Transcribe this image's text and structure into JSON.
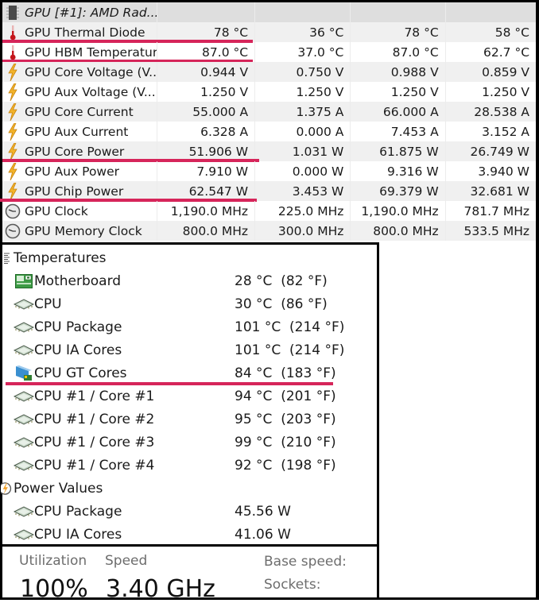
{
  "gpu_table": {
    "header": {
      "device_label": "GPU [#1]: AMD Rad...",
      "icon": "chip-icon"
    },
    "rows": [
      {
        "icon": "thermometer-icon",
        "name": "GPU Thermal Diode",
        "current": "78 °C",
        "min": "36 °C",
        "max": "78 °C",
        "avg": "58 °C",
        "highlighted": true
      },
      {
        "icon": "thermometer-icon",
        "name": "GPU HBM Temperature",
        "current": "87.0 °C",
        "min": "37.0 °C",
        "max": "87.0 °C",
        "avg": "62.7 °C",
        "highlighted": true
      },
      {
        "icon": "lightning-icon",
        "name": "GPU Core Voltage (V...",
        "current": "0.944 V",
        "min": "0.750 V",
        "max": "0.988 V",
        "avg": "0.859 V",
        "highlighted": false
      },
      {
        "icon": "lightning-icon",
        "name": "GPU Aux Voltage (V...",
        "current": "1.250 V",
        "min": "1.250 V",
        "max": "1.250 V",
        "avg": "1.250 V",
        "highlighted": false
      },
      {
        "icon": "lightning-icon",
        "name": "GPU Core Current",
        "current": "55.000 A",
        "min": "1.375 A",
        "max": "66.000 A",
        "avg": "28.538 A",
        "highlighted": false
      },
      {
        "icon": "lightning-icon",
        "name": "GPU Aux Current",
        "current": "6.328 A",
        "min": "0.000 A",
        "max": "7.453 A",
        "avg": "3.152 A",
        "highlighted": false
      },
      {
        "icon": "lightning-icon",
        "name": "GPU Core Power",
        "current": "51.906 W",
        "min": "1.031 W",
        "max": "61.875 W",
        "avg": "26.749 W",
        "highlighted": true
      },
      {
        "icon": "lightning-icon",
        "name": "GPU Aux Power",
        "current": "7.910 W",
        "min": "0.000 W",
        "max": "9.316 W",
        "avg": "3.940 W",
        "highlighted": false
      },
      {
        "icon": "lightning-icon",
        "name": "GPU Chip Power",
        "current": "62.547 W",
        "min": "3.453 W",
        "max": "69.379 W",
        "avg": "32.681 W",
        "highlighted": true
      },
      {
        "icon": "clock-icon",
        "name": "GPU Clock",
        "current": "1,190.0 MHz",
        "min": "225.0 MHz",
        "max": "1,190.0 MHz",
        "avg": "781.7 MHz",
        "highlighted": false
      },
      {
        "icon": "clock-icon",
        "name": "GPU Memory Clock",
        "current": "800.0 MHz",
        "min": "300.0 MHz",
        "max": "800.0 MHz",
        "avg": "533.5 MHz",
        "highlighted": false
      }
    ]
  },
  "sensor_tree": {
    "groups": [
      {
        "icon": "temperature-group-icon",
        "label": "Temperatures",
        "items": [
          {
            "icon": "motherboard-icon",
            "name": "Motherboard",
            "value": "28 °C  (82 °F)",
            "highlighted": false
          },
          {
            "icon": "cpu-chip-icon",
            "name": "CPU",
            "value": "30 °C  (86 °F)",
            "highlighted": false
          },
          {
            "icon": "cpu-chip-icon",
            "name": "CPU Package",
            "value": "101 °C  (214 °F)",
            "highlighted": false
          },
          {
            "icon": "cpu-chip-icon",
            "name": "CPU IA Cores",
            "value": "101 °C  (214 °F)",
            "highlighted": false
          },
          {
            "icon": "gpu-card-icon",
            "name": "CPU GT Cores",
            "value": "84 °C  (183 °F)",
            "highlighted": true
          },
          {
            "icon": "cpu-chip-icon",
            "name": "CPU #1 / Core #1",
            "value": "94 °C  (201 °F)",
            "highlighted": false
          },
          {
            "icon": "cpu-chip-icon",
            "name": "CPU #1 / Core #2",
            "value": "95 °C  (203 °F)",
            "highlighted": false
          },
          {
            "icon": "cpu-chip-icon",
            "name": "CPU #1 / Core #3",
            "value": "99 °C  (210 °F)",
            "highlighted": false
          },
          {
            "icon": "cpu-chip-icon",
            "name": "CPU #1 / Core #4",
            "value": "92 °C  (198 °F)",
            "highlighted": false
          }
        ]
      },
      {
        "icon": "power-group-icon",
        "label": "Power Values",
        "items": [
          {
            "icon": "cpu-chip-icon",
            "name": "CPU Package",
            "value": "45.56 W",
            "highlighted": false
          },
          {
            "icon": "cpu-chip-icon",
            "name": "CPU IA Cores",
            "value": "41.06 W",
            "highlighted": false
          }
        ]
      }
    ]
  },
  "task_manager": {
    "utilization_label": "Utilization",
    "utilization_value": "100%",
    "speed_label": "Speed",
    "speed_value": "3.40 GHz",
    "base_speed_label": "Base speed:",
    "sockets_label": "Sockets:"
  },
  "colors": {
    "highlight_line": "#d6255a",
    "row_alt": "#f0f0f0",
    "header_bg": "#dedede"
  }
}
